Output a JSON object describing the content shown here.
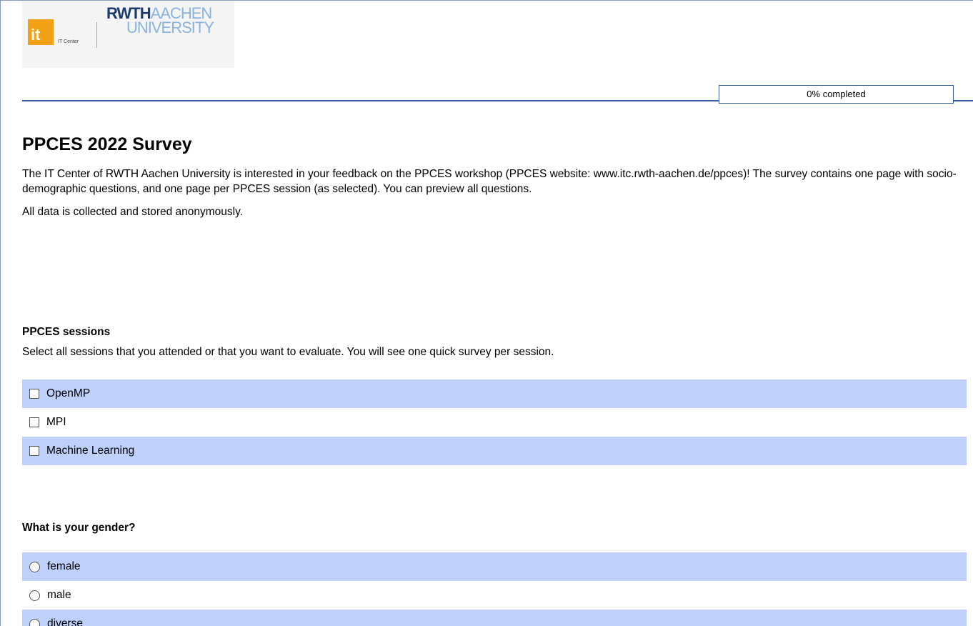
{
  "header": {
    "logo_it": "it",
    "logo_itcenter": "IT Center",
    "logo_rwth": "RWTH",
    "logo_aachen": "AACHEN",
    "logo_university": "UNIVERSITY",
    "progress_text": "0% completed",
    "progress_value": 0
  },
  "survey": {
    "title": "PPCES 2022 Survey",
    "intro": "The IT Center of RWTH Aachen University is interested in your feedback on the PPCES workshop (PPCES website: www.itc.rwth-aachen.de/ppces)! The survey contains one page with socio-demographic questions, and one page per PPCES session (as selected). You can preview all questions.",
    "privacy_note": "All data is collected and stored anonymously."
  },
  "questions": {
    "sessions": {
      "title": "PPCES sessions",
      "description": "Select all sessions that you attended or that you want to evaluate. You will see one quick survey per session.",
      "options": [
        "OpenMP",
        "MPI",
        "Machine Learning"
      ]
    },
    "gender": {
      "title": "What is your gender?",
      "options": [
        "female",
        "male",
        "diverse"
      ]
    }
  },
  "colors": {
    "row_shade": "#bfd0fb",
    "accent_line": "#3b5f9e",
    "logo_orange": "#f2a116",
    "rwth_dark": "#1c3a6e",
    "rwth_light": "#8ab3de"
  }
}
